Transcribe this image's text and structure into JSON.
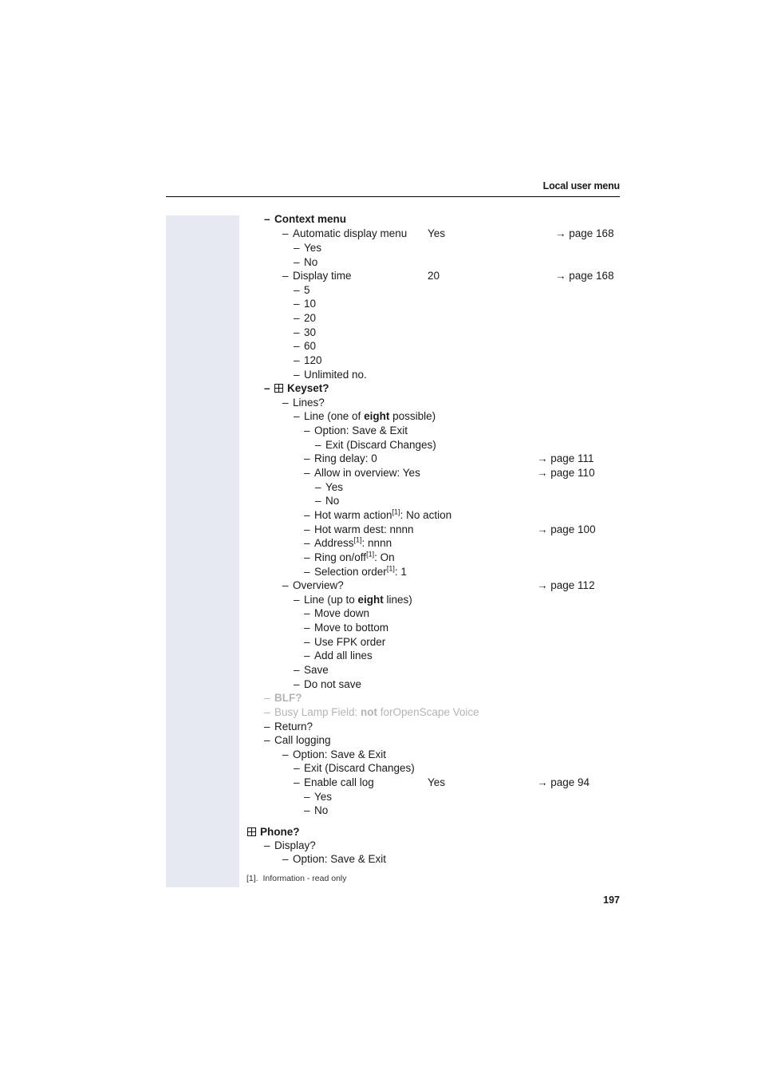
{
  "header": {
    "title": "Local user menu"
  },
  "page_number": "197",
  "footnote": {
    "marker": "[1].",
    "text": "Information - read only"
  },
  "arrow": "→",
  "items": {
    "context_menu": "Context menu",
    "auto_display": "Automatic display menu",
    "auto_display_val": "Yes",
    "auto_display_ref": "page 168",
    "yes": "Yes",
    "no": "No",
    "display_time": "Display time",
    "display_time_val": "20",
    "display_time_ref": "page 168",
    "t5": "5",
    "t10": "10",
    "t20": "20",
    "t30": "30",
    "t60": "60",
    "t120": "120",
    "unlimited": "Unlimited no.",
    "keyset": "Keyset?",
    "lines": "Lines?",
    "line_pre": "Line (one of ",
    "line_bold": "eight",
    "line_post": " possible)",
    "option_save": "Option: Save & Exit",
    "exit_discard": "Exit (Discard Changes)",
    "ring_delay": "Ring delay: 0",
    "ring_delay_ref": "page 111",
    "allow_overview": "Allow in overview: Yes",
    "allow_overview_ref": "page 110",
    "hot_warm_action": "Hot warm action",
    "hot_warm_action_val": ": No action",
    "hot_warm_dest": "Hot warm dest: nnnn",
    "hot_warm_dest_ref": "page 100",
    "address": "Address",
    "address_val": ": nnnn",
    "ring_onoff": "Ring on/off",
    "ring_onoff_val": ": On",
    "selection_order": "Selection order",
    "selection_order_val": ": 1",
    "sup": "[1]",
    "overview": "Overview?",
    "overview_ref": "page 112",
    "line_up_pre": "Line (up to ",
    "line_up_bold": "eight",
    "line_up_post": " lines)",
    "move_down": "Move down",
    "move_bottom": "Move to bottom",
    "use_fpk": "Use FPK order",
    "add_all": "Add all lines",
    "save": "Save",
    "do_not_save": "Do not save",
    "blf": "BLF?",
    "busy_pre": "Busy Lamp Field: ",
    "busy_bold": "not",
    "busy_post": " forOpenScape Voice",
    "return": "Return?",
    "call_logging": "Call logging",
    "enable_call_log": "Enable call log",
    "enable_call_log_val": "Yes",
    "enable_call_log_ref": "page 94",
    "phone": "Phone?",
    "display": "Display?"
  }
}
